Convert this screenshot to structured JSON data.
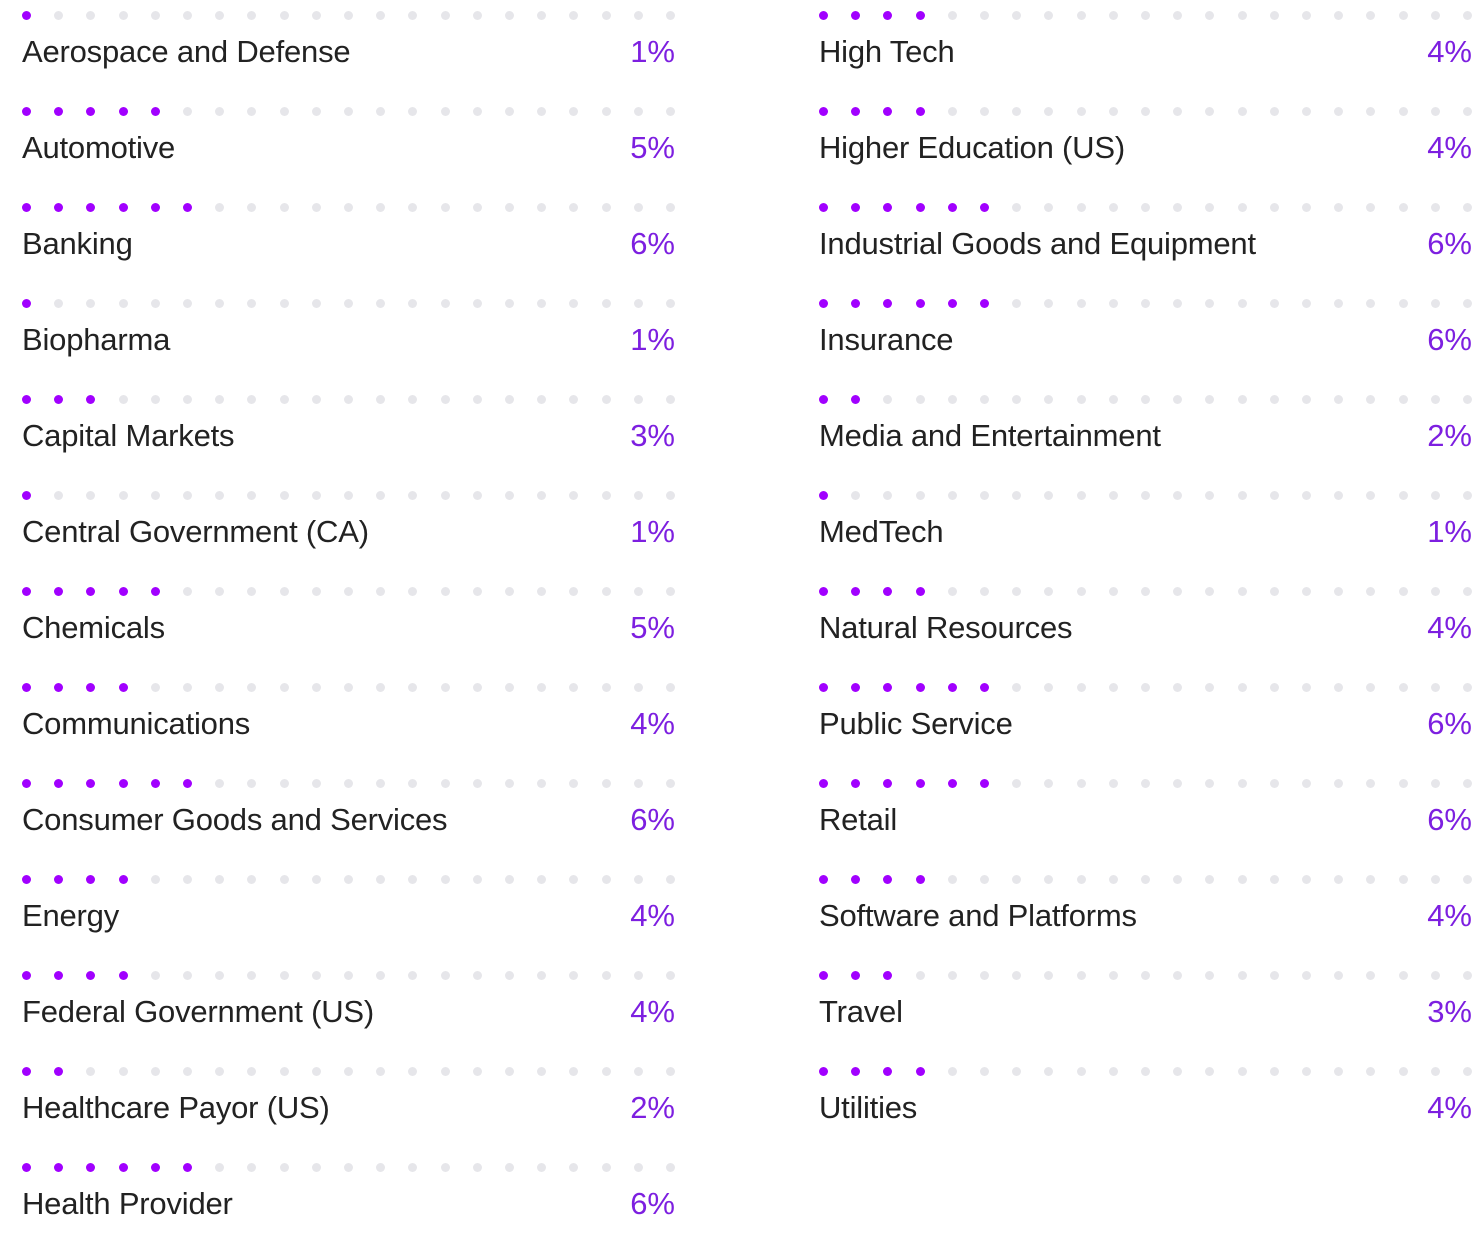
{
  "colors": {
    "filled_dot": "#a100ff",
    "empty_dot": "#e6e6ea",
    "label_text": "#222222",
    "percent_text": "#7d1fe0"
  },
  "chart_data": {
    "type": "table",
    "dots_per_row": 21,
    "columns": [
      {
        "rows": [
          {
            "category": "Aerospace and Defense",
            "value": 1,
            "label": "1%"
          },
          {
            "category": "Automotive",
            "value": 5,
            "label": "5%"
          },
          {
            "category": "Banking",
            "value": 6,
            "label": "6%"
          },
          {
            "category": "Biopharma",
            "value": 1,
            "label": "1%"
          },
          {
            "category": "Capital Markets",
            "value": 3,
            "label": "3%"
          },
          {
            "category": "Central Government (CA)",
            "value": 1,
            "label": "1%"
          },
          {
            "category": "Chemicals",
            "value": 5,
            "label": "5%"
          },
          {
            "category": "Communications",
            "value": 4,
            "label": "4%"
          },
          {
            "category": "Consumer Goods and Services",
            "value": 6,
            "label": "6%"
          },
          {
            "category": "Energy",
            "value": 4,
            "label": "4%"
          },
          {
            "category": "Federal Government (US)",
            "value": 4,
            "label": "4%"
          },
          {
            "category": "Healthcare Payor (US)",
            "value": 2,
            "label": "2%"
          },
          {
            "category": "Health Provider",
            "value": 6,
            "label": "6%"
          }
        ]
      },
      {
        "rows": [
          {
            "category": "High Tech",
            "value": 4,
            "label": "4%"
          },
          {
            "category": "Higher Education (US)",
            "value": 4,
            "label": "4%"
          },
          {
            "category": "Industrial Goods and Equipment",
            "value": 6,
            "label": "6%"
          },
          {
            "category": "Insurance",
            "value": 6,
            "label": "6%"
          },
          {
            "category": "Media and Entertainment",
            "value": 2,
            "label": "2%"
          },
          {
            "category": "MedTech",
            "value": 1,
            "label": "1%"
          },
          {
            "category": "Natural Resources",
            "value": 4,
            "label": "4%"
          },
          {
            "category": "Public Service",
            "value": 6,
            "label": "6%"
          },
          {
            "category": "Retail",
            "value": 6,
            "label": "6%"
          },
          {
            "category": "Software and Platforms",
            "value": 4,
            "label": "4%"
          },
          {
            "category": "Travel",
            "value": 3,
            "label": "3%"
          },
          {
            "category": "Utilities",
            "value": 4,
            "label": "4%"
          }
        ]
      }
    ]
  }
}
